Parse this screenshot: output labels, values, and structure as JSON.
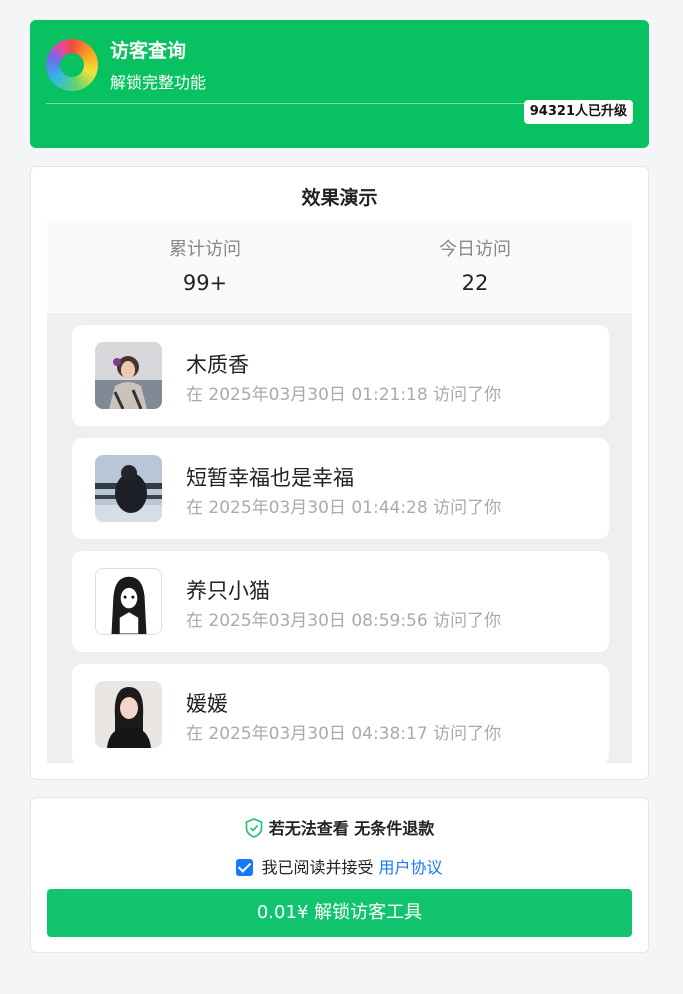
{
  "header": {
    "title": "访客查询",
    "subtitle": "解锁完整功能",
    "upgrade_badge": "94321人已升级",
    "logo_icon": "camera-aperture-logo"
  },
  "demo": {
    "title": "效果演示",
    "stats": {
      "total_label": "累计访问",
      "total_value": "99+",
      "today_label": "今日访问",
      "today_value": "22"
    },
    "visitors": [
      {
        "name": "木质香",
        "time": "在 2025年03月30日 01:21:18 访问了你"
      },
      {
        "name": "短暂幸福也是幸福",
        "time": "在 2025年03月30日 01:44:28 访问了你"
      },
      {
        "name": "养只小猫",
        "time": "在 2025年03月30日 08:59:56 访问了你"
      },
      {
        "name": "媛媛",
        "time": "在 2025年03月30日 04:38:17 访问了你"
      }
    ]
  },
  "footer": {
    "refund_text": "若无法查看 无条件退款",
    "refund_icon": "shield-check-icon",
    "agree_prefix": "我已阅读并接受",
    "agree_link": "用户协议",
    "agree_checked": true,
    "unlock_button": "0.01¥ 解锁访客工具"
  },
  "colors": {
    "brand_green": "#08c160",
    "button_green": "#12c46d",
    "link_blue": "#1677ff"
  }
}
